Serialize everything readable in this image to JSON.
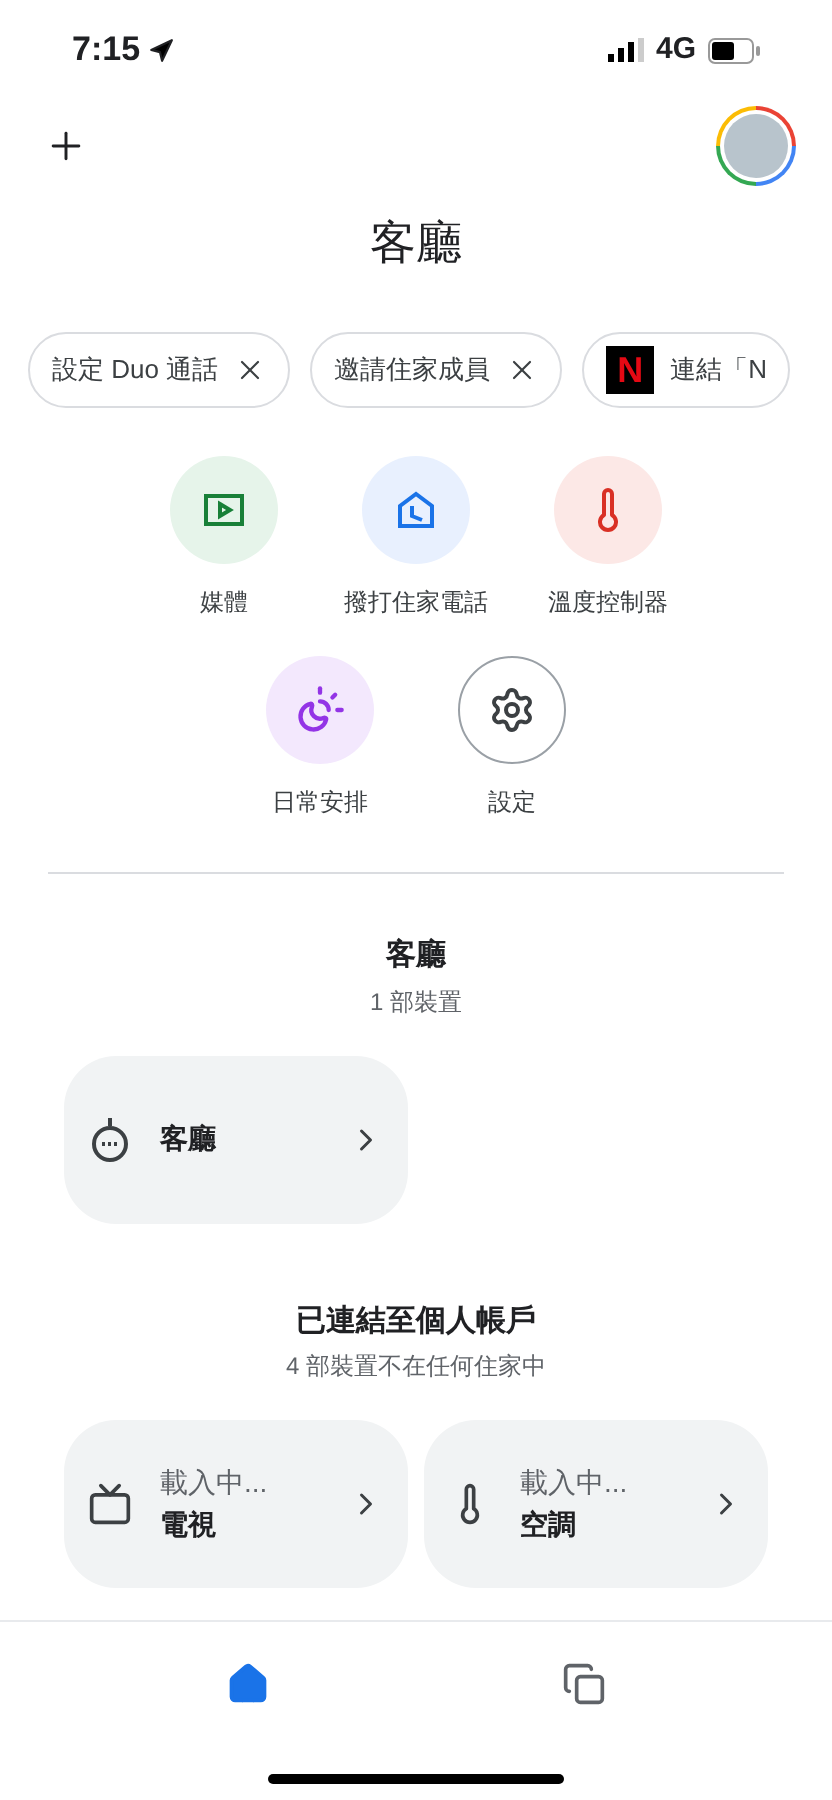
{
  "status_bar": {
    "time": "7:15",
    "network": "4G"
  },
  "title": "客廳",
  "chips": [
    {
      "label": "設定 Duo 通話",
      "kind": "dismiss"
    },
    {
      "label": "邀請住家成員",
      "kind": "dismiss"
    },
    {
      "label": "連結「N",
      "kind": "netflix",
      "logo": "N"
    }
  ],
  "actions": [
    {
      "label": "媒體",
      "kind": "media"
    },
    {
      "label": "撥打住家電話",
      "kind": "call"
    },
    {
      "label": "溫度控制器",
      "kind": "thermostat"
    },
    {
      "label": "日常安排",
      "kind": "routine"
    },
    {
      "label": "設定",
      "kind": "settings"
    }
  ],
  "sections": [
    {
      "title": "客廳",
      "subtitle": "1 部裝置",
      "devices": [
        {
          "name": "客廳",
          "kind": "speaker"
        }
      ]
    },
    {
      "title": "已連結至個人帳戶",
      "subtitle": "4 部裝置不在任何住家中",
      "devices": [
        {
          "status": "載入中...",
          "name": "電視",
          "kind": "tv"
        },
        {
          "status": "載入中...",
          "name": "空調",
          "kind": "thermometer"
        }
      ]
    }
  ],
  "nav": [
    {
      "kind": "home",
      "selected": true
    },
    {
      "kind": "feed",
      "selected": false
    }
  ]
}
